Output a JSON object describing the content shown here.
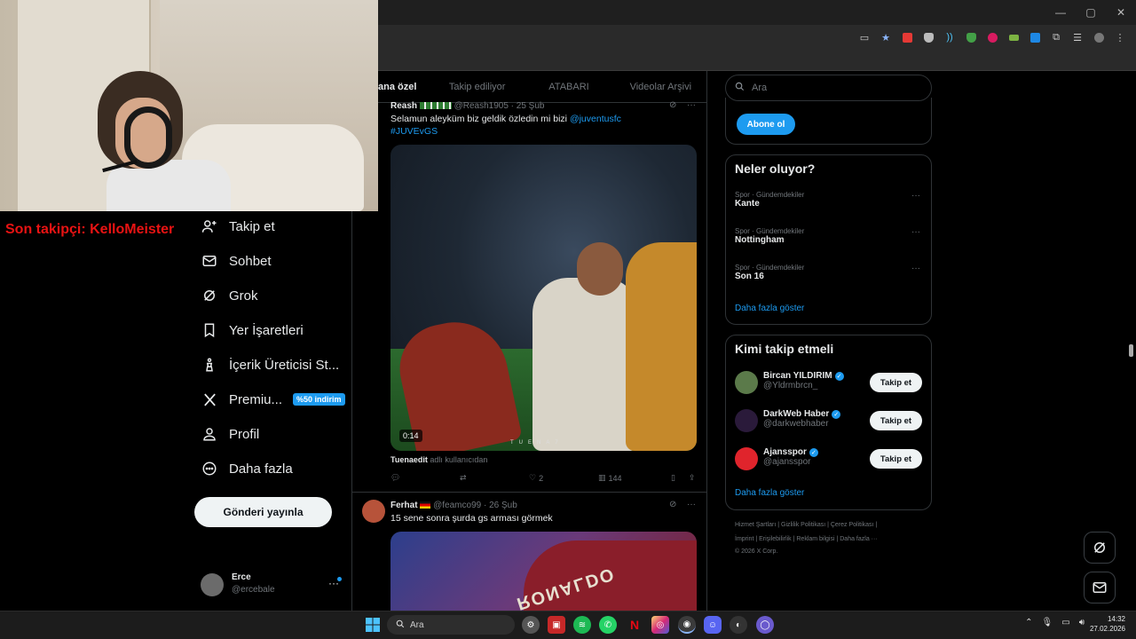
{
  "overlay": {
    "follower_text": "Son takipçi: KelloMeister"
  },
  "browser": {
    "window_controls": [
      "—",
      "▢",
      "✕"
    ]
  },
  "nav": {
    "items": [
      {
        "label": "Takip et",
        "icon": "person-add-icon",
        "glyph": "👤"
      },
      {
        "label": "Sohbet",
        "icon": "mail-icon",
        "glyph": "✉"
      },
      {
        "label": "Grok",
        "icon": "grok-icon",
        "glyph": "⊘"
      },
      {
        "label": "Yer İşaretleri",
        "icon": "bookmark-icon",
        "glyph": "🔖"
      },
      {
        "label": "İçerik Üreticisi St...",
        "icon": "creator-studio-icon",
        "glyph": "♙"
      },
      {
        "label": "Premiu...",
        "icon": "x-logo-icon",
        "glyph": "𝕏"
      },
      {
        "label": "Profil",
        "icon": "profile-icon",
        "glyph": "👤"
      },
      {
        "label": "Daha fazla",
        "icon": "more-circle-icon",
        "glyph": "⊙"
      }
    ],
    "premium_badge": "%50 indirim",
    "post_button": "Gönderi yayınla",
    "account": {
      "name": "Erce",
      "handle": "@ercebale",
      "more": "···"
    }
  },
  "tabs": [
    {
      "label": "ana özel",
      "active": true
    },
    {
      "label": "Takip ediliyor",
      "active": false
    },
    {
      "label": "ATABARI",
      "active": false
    },
    {
      "label": "Videolar Arşivi",
      "active": false
    }
  ],
  "tweets": [
    {
      "name": "Reash",
      "handle": "@Reash1905",
      "date": "25 Şub",
      "text": "Selamun aleyküm biz geldik özledin mi bizi",
      "mention": "@juventusfc",
      "hashtag": "#JUVEvGS",
      "duration": "0:14",
      "watermark": "TUENA7",
      "attribution_user": "Tuenaedit",
      "attribution_text": "adlı kullanıcıdan",
      "likes": "2",
      "views": "144"
    },
    {
      "name": "Ferhat",
      "handle": "@feamco99",
      "date": "26 Şub",
      "text": "15 sene sonra şurda gs arması görmek",
      "media_text": "RONALDO"
    }
  ],
  "right": {
    "search_placeholder": "Ara",
    "subscribe_button": "Abone ol",
    "trends_title": "Neler oluyor?",
    "trends": [
      {
        "category": "Spor · Gündemdekiler",
        "name": "Kante"
      },
      {
        "category": "Spor · Gündemdekiler",
        "name": "Nottingham"
      },
      {
        "category": "Spor · Gündemdekiler",
        "name": "Son 16"
      }
    ],
    "trends_more": "Daha fazla göster",
    "who_title": "Kimi takip etmeli",
    "who": [
      {
        "name": "Bircan YILDIRIM",
        "handle": "@Yldrmbrcn_",
        "button": "Takip et",
        "avatar_color": "#5b7a4a"
      },
      {
        "name": "DarkWeb Haber",
        "handle": "@darkwebhaber",
        "button": "Takip et",
        "avatar_color": "#2a1a3a"
      },
      {
        "name": "Ajansspor",
        "handle": "@ajansspor",
        "button": "Takip et",
        "avatar_color": "#e0242c"
      }
    ],
    "who_more": "Daha fazla göster",
    "footer_line1": "Hizmet Şartları  |  Gizlilik Politikası  |  Çerez Politikası  |",
    "footer_line2": "İmprint  |  Erişilebilirlik  |  Reklam bilgisi  |  Daha fazla ···",
    "footer_line3": "© 2026 X Corp."
  },
  "taskbar": {
    "search_placeholder": "Ara",
    "time": "14:32",
    "date": "27.02.2026"
  }
}
